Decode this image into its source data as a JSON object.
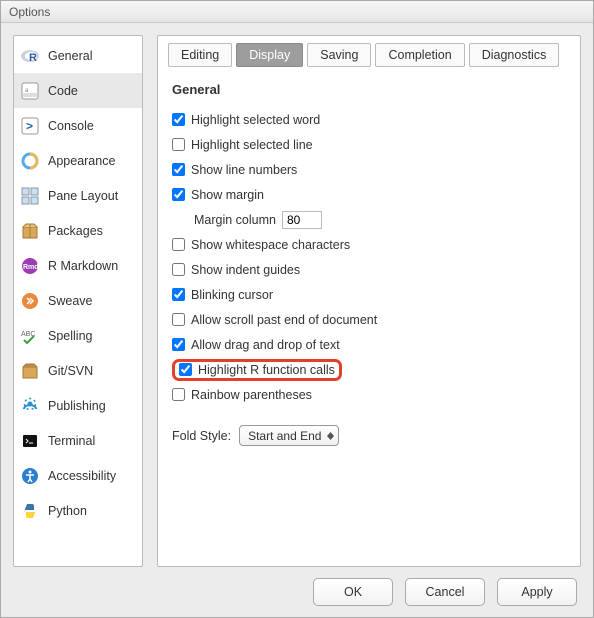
{
  "window": {
    "title": "Options"
  },
  "sidebar": {
    "items": [
      {
        "label": "General"
      },
      {
        "label": "Code"
      },
      {
        "label": "Console"
      },
      {
        "label": "Appearance"
      },
      {
        "label": "Pane Layout"
      },
      {
        "label": "Packages"
      },
      {
        "label": "R Markdown"
      },
      {
        "label": "Sweave"
      },
      {
        "label": "Spelling"
      },
      {
        "label": "Git/SVN"
      },
      {
        "label": "Publishing"
      },
      {
        "label": "Terminal"
      },
      {
        "label": "Accessibility"
      },
      {
        "label": "Python"
      }
    ],
    "selected_index": 1
  },
  "tabs": {
    "items": [
      {
        "label": "Editing"
      },
      {
        "label": "Display"
      },
      {
        "label": "Saving"
      },
      {
        "label": "Completion"
      },
      {
        "label": "Diagnostics"
      }
    ],
    "active_index": 1
  },
  "section": {
    "heading": "General",
    "options": [
      {
        "label": "Highlight selected word",
        "checked": true
      },
      {
        "label": "Highlight selected line",
        "checked": false
      },
      {
        "label": "Show line numbers",
        "checked": true
      },
      {
        "label": "Show margin",
        "checked": true
      },
      {
        "label": "Show whitespace characters",
        "checked": false
      },
      {
        "label": "Show indent guides",
        "checked": false
      },
      {
        "label": "Blinking cursor",
        "checked": true
      },
      {
        "label": "Allow scroll past end of document",
        "checked": false
      },
      {
        "label": "Allow drag and drop of text",
        "checked": true
      },
      {
        "label": "Highlight R function calls",
        "checked": true
      },
      {
        "label": "Rainbow parentheses",
        "checked": false
      }
    ],
    "margin_label": "Margin column",
    "margin_value": "80",
    "fold_label": "Fold Style:",
    "fold_value": "Start and End"
  },
  "footer": {
    "ok": "OK",
    "cancel": "Cancel",
    "apply": "Apply"
  }
}
